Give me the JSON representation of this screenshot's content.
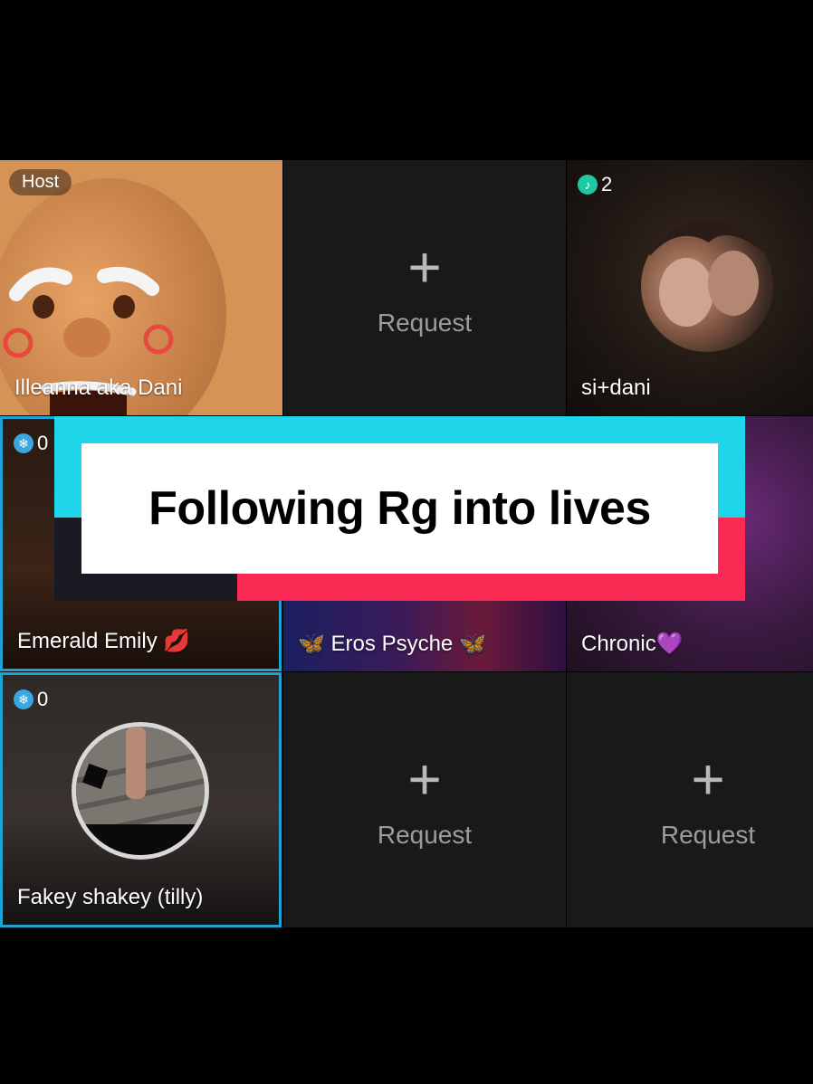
{
  "tiles": [
    {
      "name": "Illeanna aka Dani",
      "badge": "Host"
    },
    {
      "request_label": "Request"
    },
    {
      "name": "si+dani",
      "count": "2",
      "count_icon": "music-note-icon"
    },
    {
      "name": "Emerald Emily 💋",
      "count": "0",
      "count_icon": "snowflake-icon"
    },
    {
      "name": "🦋 Eros Psyche 🦋"
    },
    {
      "name": "Chronic💜"
    },
    {
      "name": "Fakey shakey (tilly)",
      "count": "0",
      "count_icon": "snowflake-icon"
    },
    {
      "request_label": "Request"
    },
    {
      "request_label": "Request"
    }
  ],
  "plus_symbol": "+",
  "overlay": {
    "caption": "Following Rg into lives"
  },
  "colors": {
    "selected_border": "#1fa3d6",
    "banner_cyan": "#20d5ea",
    "banner_red": "#fb2a54"
  }
}
